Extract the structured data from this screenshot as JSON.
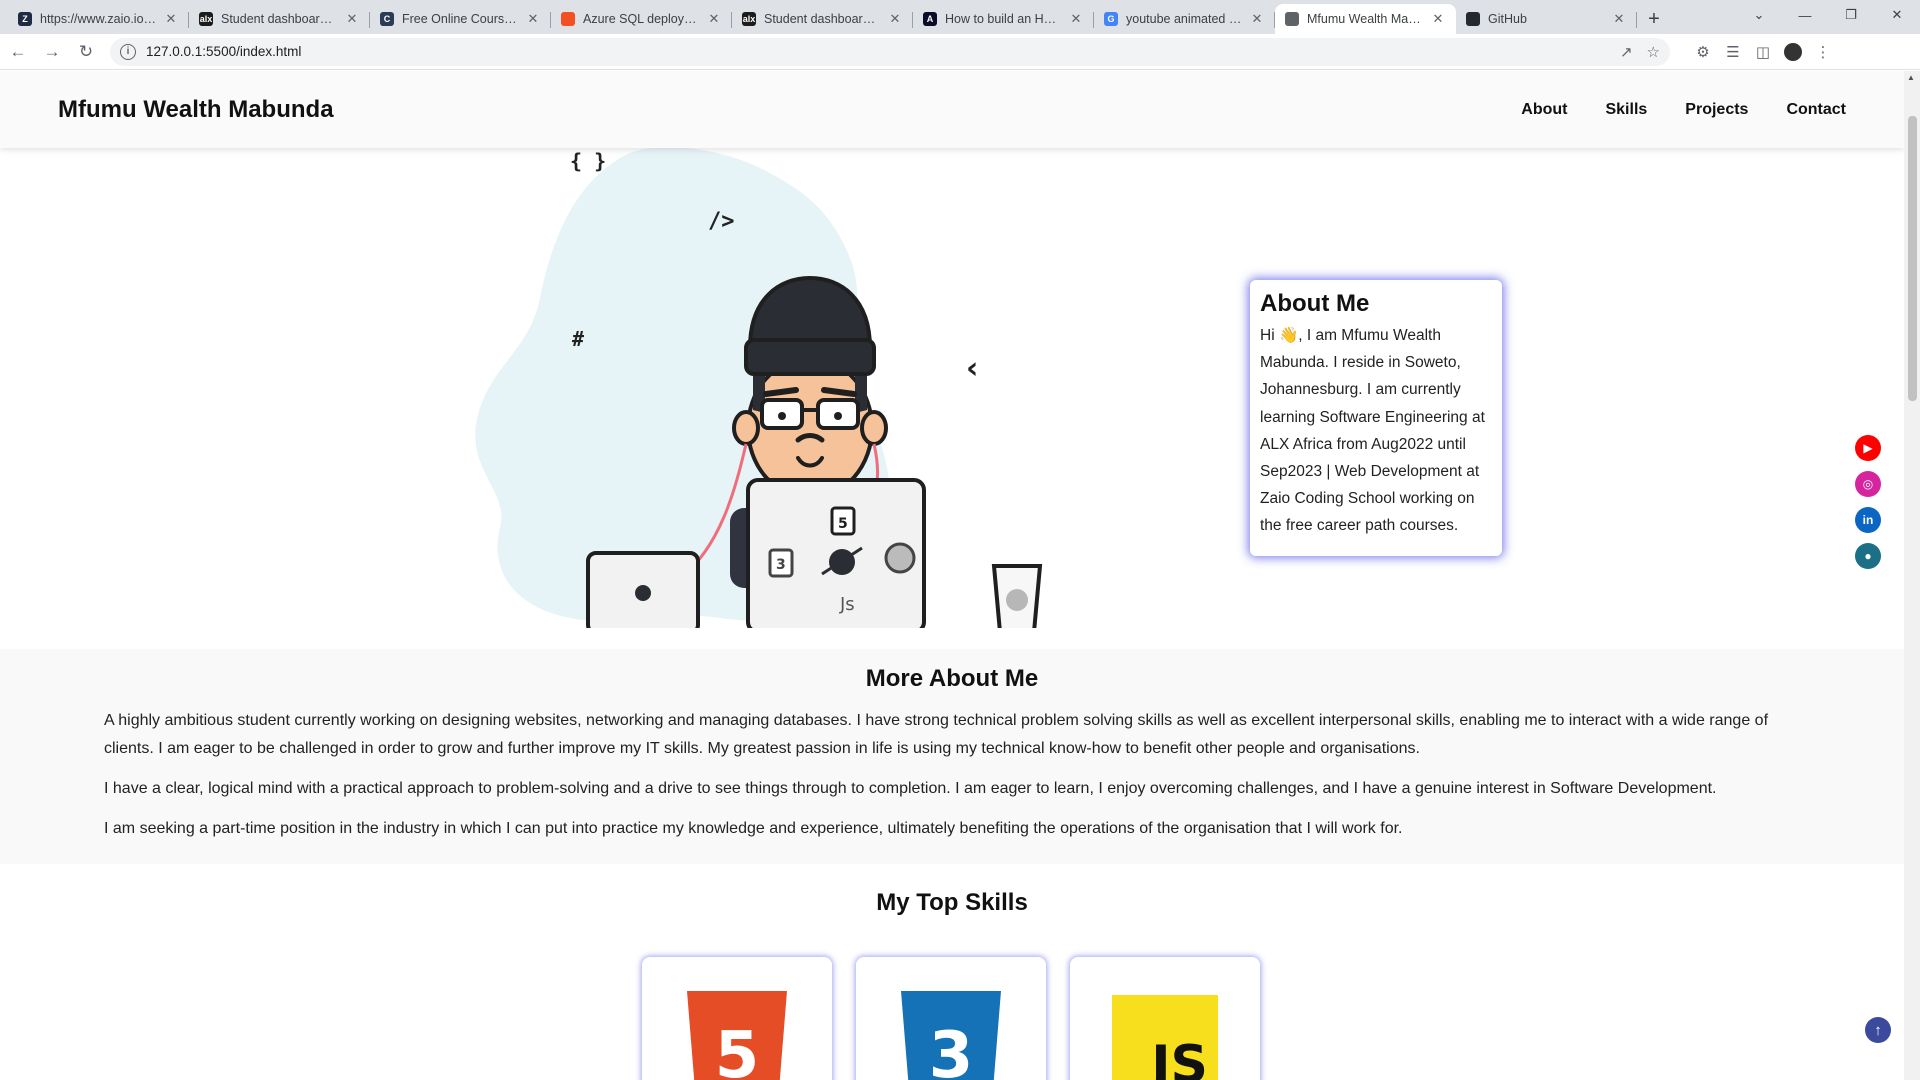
{
  "browser": {
    "tabs": [
      {
        "title": "https://www.zaio.io/ap",
        "favicon": "zaio-icon",
        "fav_color": "#1f2a44",
        "fav_text": "Z"
      },
      {
        "title": "Student dashboard | J",
        "favicon": "alx-icon",
        "fav_color": "#1c1c1c",
        "fav_text": "alx"
      },
      {
        "title": "Free Online Course: A",
        "favicon": "course-icon",
        "fav_color": "#2b3a55",
        "fav_text": "C"
      },
      {
        "title": "Azure SQL deploymen",
        "favicon": "microsoft-icon",
        "fav_color": "#f25022",
        "fav_text": ""
      },
      {
        "title": "Student dashboard | J",
        "favicon": "alx-icon",
        "fav_color": "#1c1c1c",
        "fav_text": "alx"
      },
      {
        "title": "How to build an HTML",
        "favicon": "article-icon",
        "fav_color": "#0b0b2a",
        "fav_text": "A"
      },
      {
        "title": "youtube animated ico",
        "favicon": "google-icon",
        "fav_color": "#4285f4",
        "fav_text": "G"
      },
      {
        "title": "Mfumu Wealth Mabun",
        "favicon": "globe-icon",
        "fav_color": "#5f6368",
        "fav_text": "",
        "active": true
      },
      {
        "title": "GitHub",
        "favicon": "github-icon",
        "fav_color": "#24292f",
        "fav_text": ""
      }
    ],
    "url": "127.0.0.1:5500/index.html"
  },
  "site": {
    "brand": "Mfumu Wealth Mabunda",
    "nav": [
      "About",
      "Skills",
      "Projects",
      "Contact"
    ]
  },
  "about_card": {
    "title": "About Me",
    "text": "Hi 👋, I am Mfumu Wealth Mabunda. I reside in Soweto, Johannesburg. I am currently learning Software Engineering at ALX Africa from Aug2022 until Sep2023 | Web Development at Zaio Coding School working on the free career path courses."
  },
  "socials": [
    {
      "name": "youtube-icon",
      "color": "#ff0000",
      "glyph": "▶"
    },
    {
      "name": "instagram-icon",
      "color": "#d6249f",
      "glyph": "◎"
    },
    {
      "name": "linkedin-icon",
      "color": "#0a66c2",
      "glyph": "in"
    },
    {
      "name": "github-icon",
      "color": "#1b6f86",
      "glyph": "●"
    }
  ],
  "more_about": {
    "title": "More About Me",
    "paragraphs": [
      "A highly ambitious student currently working on designing websites, networking and managing databases. I have strong technical problem solving skills as well as excellent interpersonal skills, enabling me to interact with a wide range of clients. I am eager to be challenged in order to grow and further improve my IT skills. My greatest passion in life is using my technical know-how to benefit other people and organisations.",
      "I have a clear, logical mind with a practical approach to problem-solving and a drive to see things through to completion. I am eager to learn, I enjoy overcoming challenges, and I have a genuine interest in Software Development.",
      "I am seeking a part-time position in the industry in which I can put into practice my knowledge and experience, ultimately benefiting the operations of the organisation that I will work for."
    ]
  },
  "skills": {
    "title": "My Top Skills",
    "items": [
      {
        "name": "html5-logo",
        "digit": "5",
        "color": "#e44d26"
      },
      {
        "name": "css3-logo",
        "digit": "3",
        "color": "#1572b6"
      },
      {
        "name": "javascript-logo",
        "digit": "JS",
        "color": "#f7df1e"
      }
    ]
  },
  "illustration": {
    "glyph_braces": "{ }",
    "glyph_slash": "/>",
    "glyph_hash": "#",
    "glyph_chevron": "‹",
    "laptop_js": "Js"
  }
}
